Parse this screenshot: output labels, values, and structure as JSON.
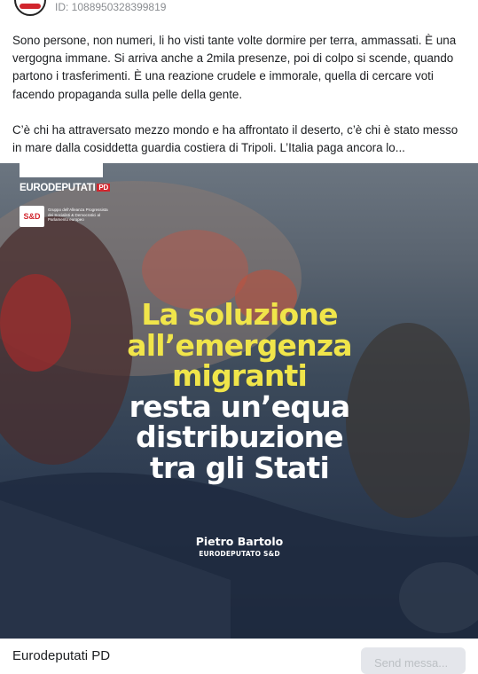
{
  "header": {
    "ad_id": "ID: 1088950328399819"
  },
  "post": {
    "paragraph_1": "Sono persone, non numeri, li ho visti tante volte dormire per terra, ammassati. È una vergogna immane. Si arriva anche a 2mila presenze, poi di colpo si scende, quando partono i trasferimenti. È una reazione crudele e immorale, quella di cercare voti facendo propaganda sulla pelle della gente.",
    "paragraph_2": "C’è chi ha attraversato mezzo mondo e ha affrontato il deserto, c’è chi è stato messo in mare dalla cosiddetta guardia costiera di Tripoli. L’Italia paga ancora lo..."
  },
  "creative": {
    "brand": "EURODEPUTATI",
    "brand_badge": "PD",
    "sd_logo": "S&D",
    "sd_text": "Gruppo dell'Alleanza Progressista dei Socialisti & Democratici al Parlamento europeo",
    "headline_yellow": [
      "La soluzione",
      "all’emergenza",
      "migranti"
    ],
    "headline_white": [
      "resta un’equa",
      "distribuzione",
      "tra gli Stati"
    ],
    "author_name": "Pietro Bartolo",
    "author_role": "EURODEPUTATO S&D",
    "colors": {
      "headline_yellow": "#f0e54a",
      "pd_red": "#d1252d"
    }
  },
  "footer": {
    "page_name": "Eurodeputati PD",
    "send_button": "Send messa..."
  }
}
